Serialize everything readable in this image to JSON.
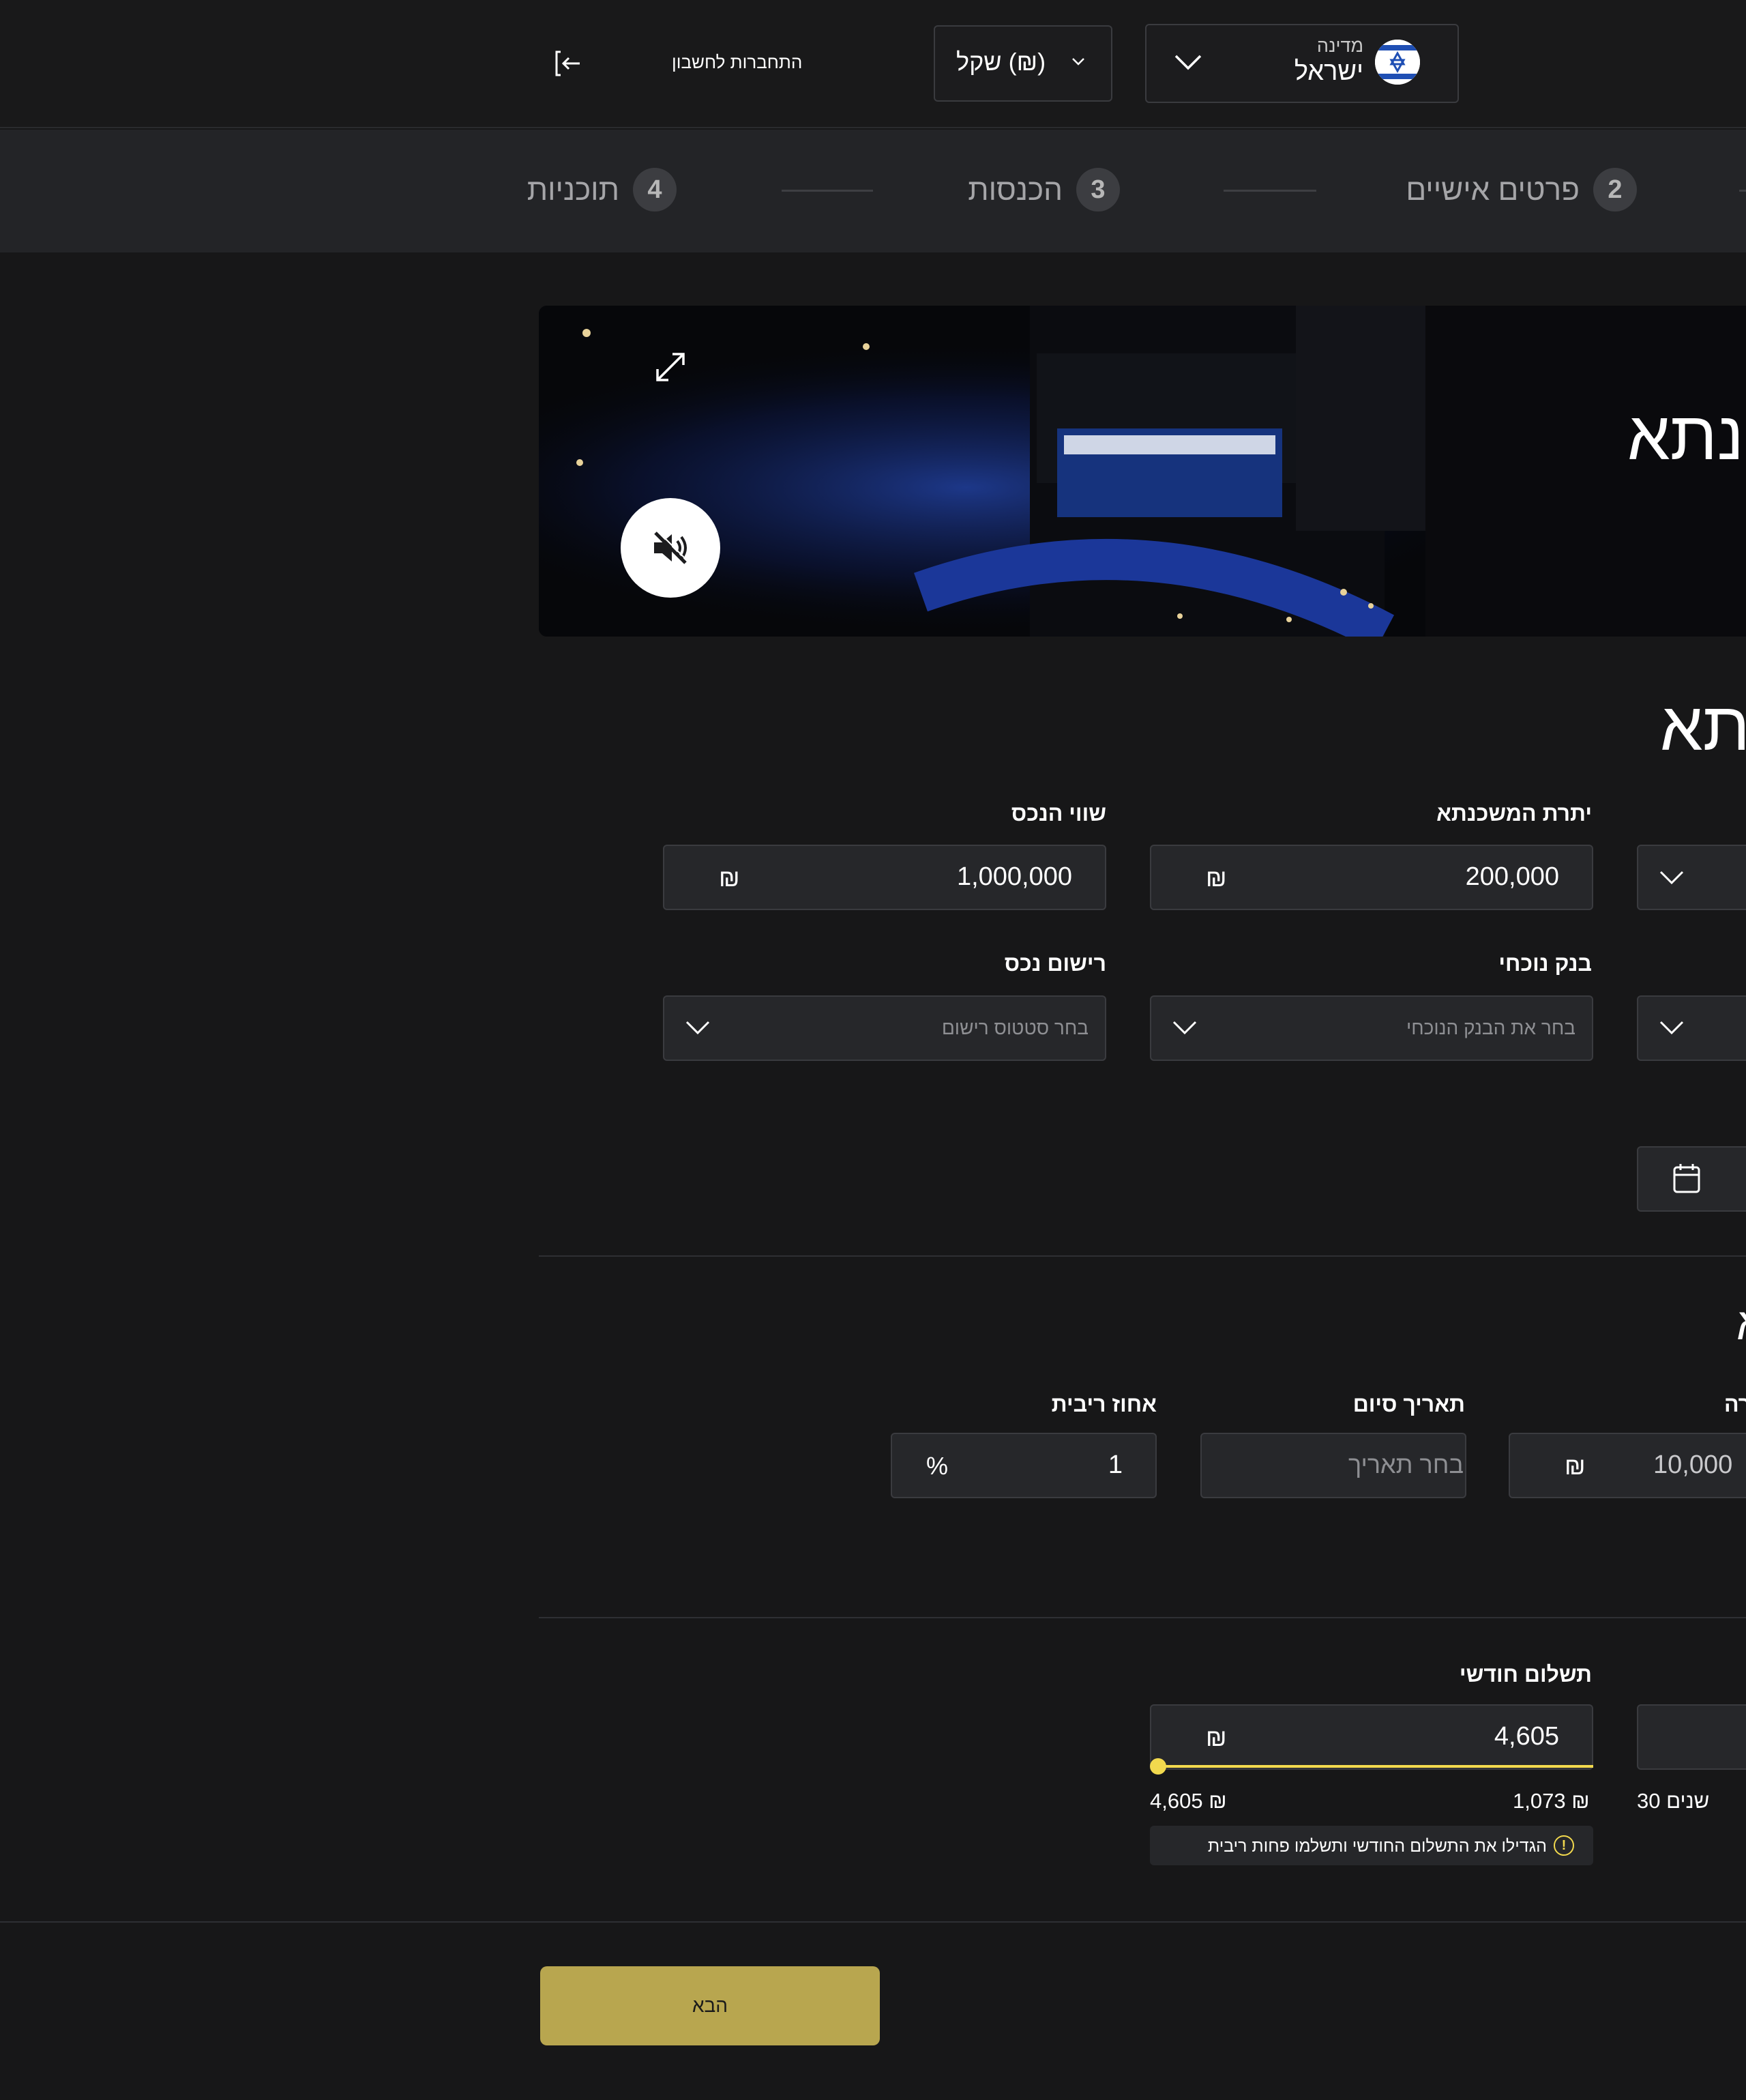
{
  "header": {
    "country_label": "מדינה",
    "country_value": "ישראל",
    "currency_value": "(₪) שקל",
    "login_label": "התחברות לחשבון"
  },
  "stepper": {
    "steps": [
      {
        "number": "2",
        "label": "פרטים אישיים"
      },
      {
        "number": "3",
        "label": "הכנסות"
      },
      {
        "number": "4",
        "label": "תוכניות"
      }
    ]
  },
  "video": {
    "title": "נתא"
  },
  "section": {
    "title": "תא"
  },
  "fields": {
    "property_value": {
      "label": "שווי הנכס",
      "value": "1,000,000",
      "currency": "₪"
    },
    "mortgage_balance": {
      "label": "יתרת המשכנתא",
      "value": "200,000",
      "currency": "₪"
    },
    "property_registration": {
      "label": "רישום נכס",
      "placeholder": "בחר סטטוס רישום"
    },
    "current_bank": {
      "label": "בנק נוכחי",
      "placeholder": "בחר את הבנק הנוכחי"
    },
    "interest_rate": {
      "label": "אחוז ריבית",
      "value": "1",
      "unit": "%"
    },
    "end_date": {
      "label": "תאריך סיום",
      "placeholder": "בחר תאריך"
    },
    "amount": {
      "label_partial": "רה",
      "value": "10,000",
      "currency": "₪"
    },
    "partial_letter": "א"
  },
  "monthly_payment": {
    "label": "תשלום חודשי",
    "value": "4,605",
    "currency": "₪",
    "min_label": "1,073 ₪",
    "max_label": "4,605 ₪",
    "slider_fraction": 1.0,
    "years_label": "30 שנים",
    "hint": "הגדילו את התשלום החודשי ותשלמו פחות ריבית",
    "hint_icon": "!"
  },
  "footer": {
    "next_label": "הבא"
  },
  "colors": {
    "accent": "#f2d94e",
    "button": "#b8a64f",
    "background": "#171718"
  }
}
